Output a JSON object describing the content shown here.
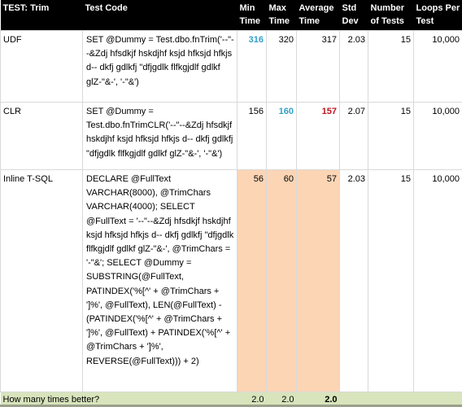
{
  "table": {
    "headers": [
      "TEST: Trim",
      "Test Code",
      "Min Time",
      "Max Time",
      "Average Time",
      "Std Dev",
      "Number of Tests",
      "Loops Per Test"
    ],
    "rows": [
      {
        "test": "UDF",
        "code": "SET @Dummy = Test.dbo.fnTrim('--\"--&Zdj hfsdkjf hskdjhf ksjd hfksjd hfkjs d-- dkfj gdlkfj \"dfjgdlk flfkgjdlf gdlkf  glZ-\"&-', '-\"&')",
        "min": "316",
        "max": "320",
        "avg": "317",
        "std": "2.03",
        "num": "15",
        "loops": "10,000"
      },
      {
        "test": "CLR",
        "code": "SET @Dummy = Test.dbo.fnTrimCLR('--\"--&Zdj hfsdkjf hskdjhf ksjd hfksjd hfkjs d-- dkfj gdlkfj \"dfjgdlk flfkgjdlf gdlkf glZ-\"&-', '-\"&')",
        "min": "156",
        "max": "160",
        "avg": "157",
        "std": "2.07",
        "num": "15",
        "loops": "10,000"
      },
      {
        "test": "Inline T-SQL",
        "code": "DECLARE @FullText VARCHAR(8000), @TrimChars VARCHAR(4000);  SELECT @FullText = '--\"--&Zdj hfsdkjf hskdjhf ksjd hfksjd hfkjs d-- dkfj gdlkfj \"dfjgdlk flfkgjdlf gdlkf  glZ-\"&-', @TrimChars = '-\"&';  SELECT @Dummy = SUBSTRING(@FullText, PATINDEX('%[^' + @TrimChars + ']%', @FullText), LEN(@FullText) - (PATINDEX('%[^' + @TrimChars + ']%', @FullText) + PATINDEX('%[^' + @TrimChars + ']%', REVERSE(@FullText))) + 2)",
        "min": "56",
        "max": "60",
        "avg": "57",
        "std": "2.03",
        "num": "15",
        "loops": "10,000"
      }
    ],
    "footer": {
      "label": "How many times better?",
      "min": "2.0",
      "max": "2.0",
      "avg": "2.0"
    }
  },
  "colors": {
    "header_bg": "#000000",
    "highlight_bg": "#fcd5b5",
    "footer_bg": "#d8e4bc",
    "accent_blue": "#31a0c8",
    "accent_red": "#c0141c"
  }
}
